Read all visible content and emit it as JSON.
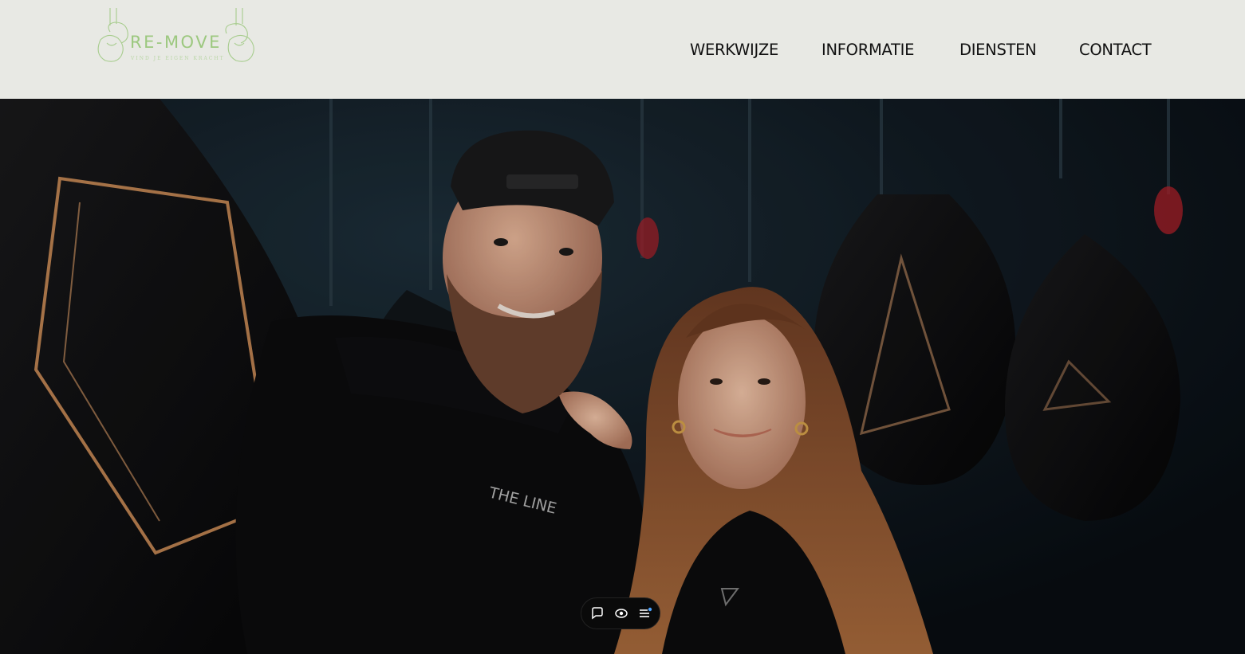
{
  "brand": {
    "name": "RE-MOVE",
    "tagline": "VIND JE EIGEN KRACHT"
  },
  "nav": {
    "items": [
      "WERKWIJZE",
      "INFORMATIE",
      "DIENSTEN",
      "CONTACT"
    ]
  },
  "hero": {
    "shirt_text": "THE LINE",
    "image_alt": "man-and-woman-in-boxing-gym"
  },
  "widget": {
    "icons": [
      "chat-icon",
      "eye-icon",
      "menu-icon"
    ]
  },
  "colors": {
    "header_bg": "#e8e9e4",
    "brand_green": "#9cc87f",
    "nav_text": "#111111",
    "hero_bg": "#0d141a"
  }
}
